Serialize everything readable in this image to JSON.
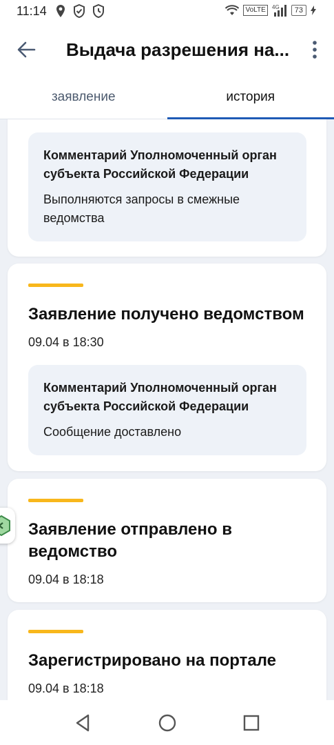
{
  "status_bar": {
    "time": "11:14",
    "volte": "VoLTE",
    "network": "4G",
    "battery": "73",
    "icons": [
      "location-icon",
      "shield-check-icon",
      "shield-clock-icon",
      "wifi-icon",
      "signal-icon",
      "battery-icon"
    ]
  },
  "app_bar": {
    "title": "Выдача разрешения на...",
    "back_icon": "arrow-left-icon",
    "more_icon": "more-vertical-icon"
  },
  "tabs": [
    {
      "label": "заявление",
      "active": false
    },
    {
      "label": "история",
      "active": true
    }
  ],
  "colors": {
    "accent": "#1f5ab5",
    "status_bar_yellow": "#f8b71c",
    "comment_bg": "#eef2f8",
    "page_bg": "#eef1f6"
  },
  "history": [
    {
      "comment": {
        "heading": "Комментарий Уполномоченный орган субъекта Российской Федерации",
        "text": "Выполняются запросы в смежные ведомства"
      }
    },
    {
      "title": "Заявление получено ведомством",
      "date": "09.04 в 18:30",
      "comment": {
        "heading": "Комментарий Уполномоченный орган субъекта Российской Федерации",
        "text": "Сообщение доставлено"
      }
    },
    {
      "title": "Заявление отправлено в ведомство",
      "date": "09.04 в 18:18"
    },
    {
      "title": "Зарегистрировано на портале",
      "date": "09.04 в 18:18"
    }
  ],
  "nav_bar": {
    "icons": [
      "nav-back-icon",
      "nav-home-icon",
      "nav-recents-icon"
    ]
  }
}
